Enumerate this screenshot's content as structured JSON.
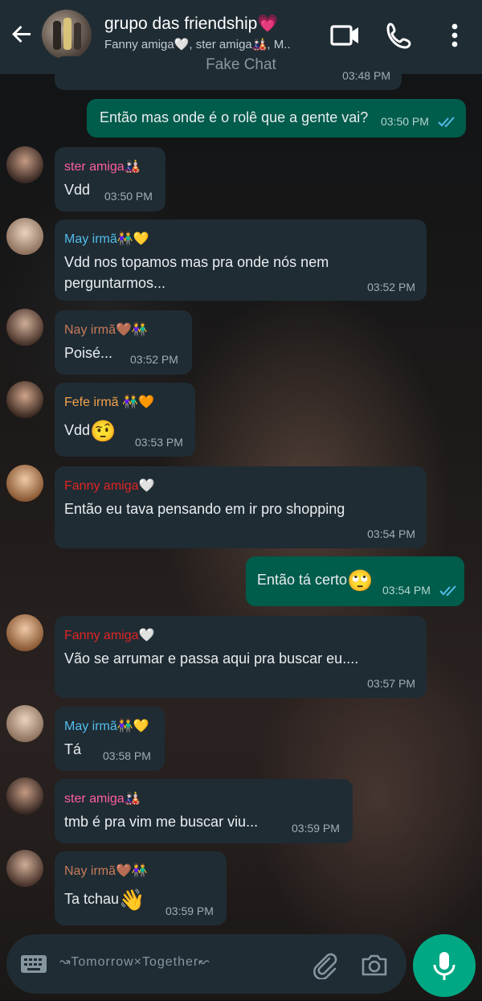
{
  "header": {
    "title": "grupo das friendship💗",
    "subtitle": "Fanny amiga🤍, ster amiga🎎, M..",
    "watermark": "Fake Chat"
  },
  "messages": [
    {
      "direction": "in",
      "time": "03:48 PM"
    },
    {
      "direction": "out",
      "text": "Então mas onde é o rolê que a gente vai?",
      "time": "03:50 PM"
    },
    {
      "direction": "in",
      "sender": "ster amiga🎎",
      "sender_color": "#ff5f9e",
      "text": "Vdd",
      "time": "03:50 PM"
    },
    {
      "direction": "in",
      "sender": "May irmã👫💛",
      "sender_color": "#53bdeb",
      "text_line1": "Vdd nos  topamos mas pra onde nós nem",
      "text_line2": "perguntarmos...",
      "time": "03:52 PM"
    },
    {
      "direction": "in",
      "sender": "Nay irmã🤎👫",
      "sender_color": "#c97b5a",
      "text": "Poisé...",
      "time": "03:52 PM"
    },
    {
      "direction": "in",
      "sender": "Fefe irmã 👫🧡",
      "sender_color": "#f2a14b",
      "text": "Vdd",
      "emoji": "🤨",
      "time": "03:53 PM"
    },
    {
      "direction": "in",
      "sender": "Fanny amiga🤍",
      "sender_color": "#e02424",
      "text": "Então eu tava pensando em ir pro shopping",
      "time": "03:54 PM"
    },
    {
      "direction": "out",
      "text": "Então tá certo",
      "emoji": "🙄",
      "time": "03:54 PM"
    },
    {
      "direction": "in",
      "sender": "Fanny amiga🤍",
      "sender_color": "#e02424",
      "text": "Vão se arrumar e passa aqui pra buscar eu....",
      "time": "03:57 PM"
    },
    {
      "direction": "in",
      "sender": "May irmã👫💛",
      "sender_color": "#53bdeb",
      "text": "Tá",
      "time": "03:58 PM"
    },
    {
      "direction": "in",
      "sender": "ster amiga🎎",
      "sender_color": "#ff5f9e",
      "text": " tmb é pra vim me buscar viu...",
      "time": "03:59 PM"
    },
    {
      "direction": "in",
      "sender": "Nay irmã🤎👫",
      "sender_color": "#c97b5a",
      "text": "Ta tchau",
      "emoji": "👋",
      "time": "03:59 PM"
    }
  ],
  "composer": {
    "placeholder": "↝Tomorrow×Together↜"
  },
  "colors": {
    "header_bg": "#1f2c34",
    "incoming_bubble": "#1f2c34",
    "outgoing_bubble": "#005c4b",
    "accent": "#00a884",
    "read_tick": "#53bdeb"
  },
  "icons": [
    "back-arrow-icon",
    "video-call-icon",
    "phone-icon",
    "more-vert-icon",
    "keyboard-icon",
    "attach-icon",
    "camera-icon",
    "mic-icon",
    "double-tick-icon"
  ]
}
